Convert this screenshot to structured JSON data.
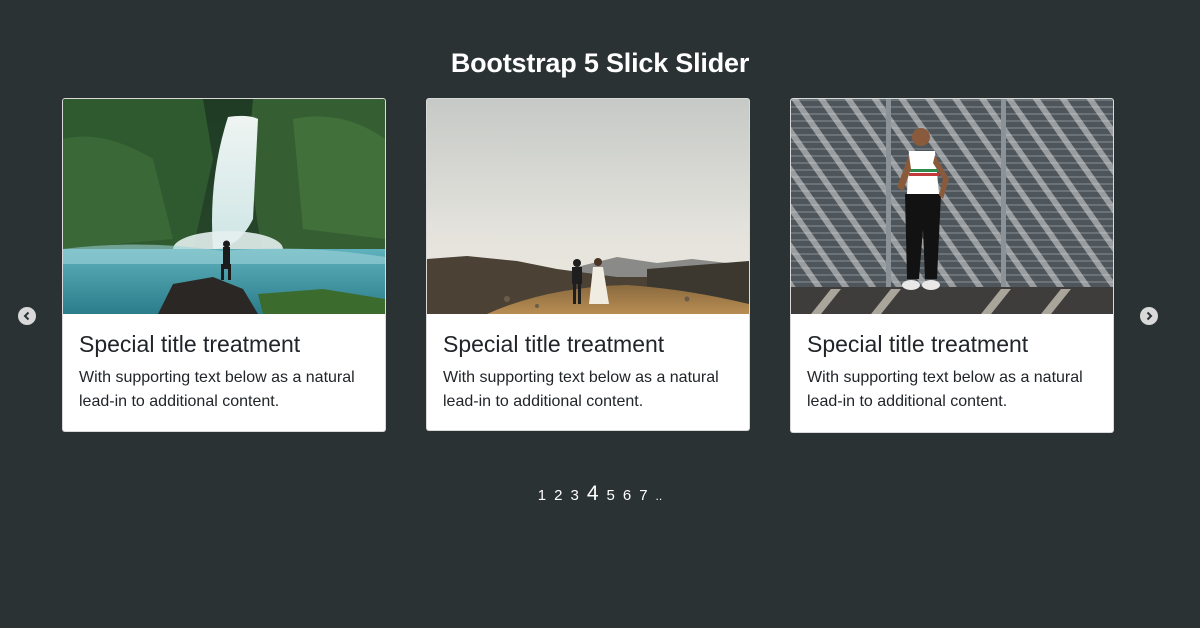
{
  "page": {
    "title": "Bootstrap 5 Slick Slider"
  },
  "slider": {
    "prev_icon": "chevron-left-circle-icon",
    "next_icon": "chevron-right-circle-icon",
    "cards": [
      {
        "image": "waterfall-photo",
        "title": "Special title treatment",
        "text": "With supporting text below as a natural lead-in to additional content."
      },
      {
        "image": "couple-in-field-photo",
        "title": "Special title treatment",
        "text": "With supporting text below as a natural lead-in to additional content."
      },
      {
        "image": "woman-against-shutters-photo",
        "title": "Special title treatment",
        "text": "With supporting text below as a natural lead-in to additional content."
      }
    ]
  },
  "pagination": {
    "pages": [
      "1",
      "2",
      "3",
      "4",
      "5",
      "6",
      "7"
    ],
    "active": "4",
    "more": ".."
  },
  "colors": {
    "background": "#2b3234",
    "card": "#ffffff",
    "text": "#212529"
  }
}
